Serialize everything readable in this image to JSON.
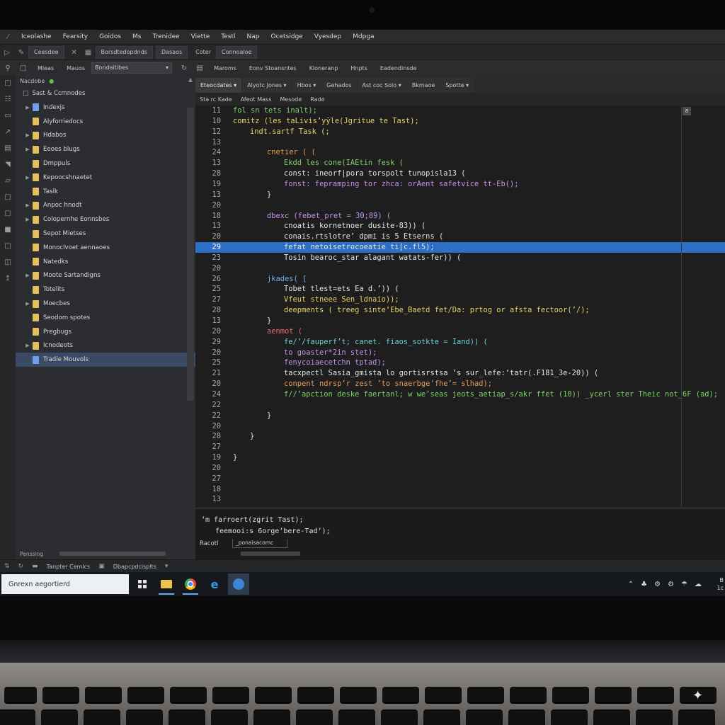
{
  "menubar": {
    "items": [
      "Iceolashe",
      "Fearsity",
      "Goidos",
      "Ms",
      "Trenidee",
      "Viette",
      "Testl",
      "Nap",
      "Ocetsidge",
      "Vyesdep",
      "Mdpga"
    ]
  },
  "toolbar1": {
    "items": [
      "Ceesdee",
      "Borsdtedopdnds",
      "Dasaos",
      "Coter",
      "Connoaloe"
    ]
  },
  "toolbar2": {
    "items": [
      "Mieas",
      "Mauos",
      "Maroms",
      "Eonv Stoansntes",
      "Kloneranp",
      "Hnpts",
      "Eadendinsde"
    ],
    "select_value": "Bondaitibes"
  },
  "explorer": {
    "header": "Nacdobe",
    "root": "Sast & Ccmnodes",
    "items": [
      {
        "label": "Indexjs",
        "kind": "file",
        "arrow": true
      },
      {
        "label": "Alyforriedocs",
        "kind": "folder",
        "arrow": false
      },
      {
        "label": "Hdabos",
        "kind": "folder",
        "arrow": true
      },
      {
        "label": "Eeoes blugs",
        "kind": "folder",
        "arrow": true
      },
      {
        "label": "Dmppuls",
        "kind": "folder",
        "arrow": false
      },
      {
        "label": "Kepoocshnaetet",
        "kind": "folder",
        "arrow": true
      },
      {
        "label": "Taslk",
        "kind": "folder",
        "arrow": false
      },
      {
        "label": "Anpoc hnodt",
        "kind": "folder",
        "arrow": true
      },
      {
        "label": "Colopernhe Eonnsbes",
        "kind": "folder",
        "arrow": true
      },
      {
        "label": "Sepot Mietses",
        "kind": "folder",
        "arrow": false
      },
      {
        "label": "Monoclvoet aennaoes",
        "kind": "folder",
        "arrow": false
      },
      {
        "label": "Natedks",
        "kind": "folder",
        "arrow": false
      },
      {
        "label": "Moote Sartandigns",
        "kind": "folder",
        "arrow": true
      },
      {
        "label": "Totelits",
        "kind": "folder",
        "arrow": false
      },
      {
        "label": "Moecbes",
        "kind": "folder",
        "arrow": true
      },
      {
        "label": "Seodom spotes",
        "kind": "folder",
        "arrow": false
      },
      {
        "label": "Pregbugs",
        "kind": "folder",
        "arrow": false
      },
      {
        "label": "Icnodeots",
        "kind": "folder",
        "arrow": true
      },
      {
        "label": "Tradie Mouvols",
        "kind": "file",
        "arrow": false,
        "selected": true
      }
    ],
    "footer": "Penssing"
  },
  "editor": {
    "tabs": [
      "Eteocdates",
      "Alyotc Jones",
      "Hbos",
      "Gehados",
      "Ast coc Solo",
      "Bkmaoe",
      "Spotte"
    ],
    "breadcrumb": [
      "Sta rc Kade",
      "Afeot Mass",
      "Mesode",
      "Rade"
    ],
    "minimap_label": "8",
    "lines": [
      {
        "n": "11",
        "indent": 0,
        "text": "fol sn tets inalt);",
        "color": "g"
      },
      {
        "n": "10",
        "indent": 0,
        "text": "comitz (les taLivisʼyȳle(Jgritue te Tast);",
        "color": "y"
      },
      {
        "n": "12",
        "indent": 2,
        "text": "indt.sartf Task (;",
        "color": "y"
      },
      {
        "n": "13",
        "indent": 0,
        "text": "",
        "color": "w"
      },
      {
        "n": "24",
        "indent": 4,
        "text": "cnetier ( (",
        "color": "o"
      },
      {
        "n": "13",
        "indent": 6,
        "text": "Ekdd les cone(IAEtin fesk (",
        "color": "g"
      },
      {
        "n": "28",
        "indent": 6,
        "text": "const: ineorf|pora torspolt tunopisla13 (",
        "color": "w"
      },
      {
        "n": "19",
        "indent": 6,
        "text": "fonst: fepramping tor zhca: orAent safetvice tt-Eb();",
        "color": "p"
      },
      {
        "n": "13",
        "indent": 4,
        "text": "}",
        "color": "w"
      },
      {
        "n": "20",
        "indent": 0,
        "text": "",
        "color": "w"
      },
      {
        "n": "18",
        "indent": 4,
        "text": "dbexc (febet_pret = 30;89) (",
        "color": "p"
      },
      {
        "n": "13",
        "indent": 6,
        "text": "cnoatis kornetnoer dusite-83)) (",
        "color": "w"
      },
      {
        "n": "20",
        "indent": 6,
        "text": "conais.rtslotreʼ dpmi is 5 Etserns (",
        "color": "w"
      },
      {
        "n": "29",
        "indent": 6,
        "text": "fefat netoisetrocoeatie ti[c.fl5);",
        "color": "w",
        "highlight": true
      },
      {
        "n": "23",
        "indent": 6,
        "text": "Tosin bearoc_star alagant watats-fer)) (",
        "color": "w"
      },
      {
        "n": "20",
        "indent": 0,
        "text": "",
        "color": "w"
      },
      {
        "n": "26",
        "indent": 4,
        "text": "jkades( [",
        "color": "b"
      },
      {
        "n": "25",
        "indent": 6,
        "text": "Tobet tlest=ets Ea d.ʼ)) (",
        "color": "w"
      },
      {
        "n": "27",
        "indent": 6,
        "text": "Vfeut stneee Sen_ldnaio));",
        "color": "y"
      },
      {
        "n": "28",
        "indent": 6,
        "text": "deepments ( treeg sinteʻEbe_Baetd fet/Da: prtog or afsta fectoor(ʼ/);",
        "color": "y"
      },
      {
        "n": "13",
        "indent": 4,
        "text": "}",
        "color": "w"
      },
      {
        "n": "20",
        "indent": 4,
        "text": "aenmot (",
        "color": "r"
      },
      {
        "n": "29",
        "indent": 6,
        "text": "fe/ʼ/fauperfʼt; canet. fiaos_sotkte = Iand)) (",
        "color": "c"
      },
      {
        "n": "20",
        "indent": 6,
        "text": "to goaster*2in stet);",
        "color": "p"
      },
      {
        "n": "25",
        "indent": 6,
        "text": "fenycoiaecetchn tptad);",
        "color": "p"
      },
      {
        "n": "21",
        "indent": 6,
        "text": "tacxpectl Sasia_gmista lo gortisrstsa ʼs sur_lefe:ʻtatr(.F181_3e-20)) (",
        "color": "w"
      },
      {
        "n": "20",
        "indent": 6,
        "text": "conpent ndrspʼr zest ʼto snaerbge'fheʼ= slhad);",
        "color": "o"
      },
      {
        "n": "24",
        "indent": 6,
        "text": "f//ʼapction deske faertanl; w weʼseas jeots_aetiap_s/akr ffet (10)) _ycerl ster Theic not_6F (ad);",
        "color": "g"
      },
      {
        "n": "22",
        "indent": 0,
        "text": "",
        "color": "w"
      },
      {
        "n": "22",
        "indent": 4,
        "text": "}",
        "color": "w"
      },
      {
        "n": "20",
        "indent": 0,
        "text": "",
        "color": "w"
      },
      {
        "n": "28",
        "indent": 2,
        "text": "}",
        "color": "w"
      },
      {
        "n": "27",
        "indent": 0,
        "text": "",
        "color": "w"
      },
      {
        "n": "19",
        "indent": 0,
        "text": "}",
        "color": "w"
      },
      {
        "n": "20",
        "indent": 0,
        "text": "",
        "color": "w"
      },
      {
        "n": "27",
        "indent": 0,
        "text": "",
        "color": "w"
      },
      {
        "n": "18",
        "indent": 0,
        "text": "",
        "color": "w"
      },
      {
        "n": "13",
        "indent": 0,
        "text": "",
        "color": "w"
      }
    ]
  },
  "terminal": {
    "line1": "ʼm farroert(zgrit Tast);",
    "line2": "feemooi:s 6orgeʼbere-Tadʼ);",
    "prompt": "Racotl",
    "input": "_ponaisacomc"
  },
  "statusbar": {
    "items": [
      "Tanpter Cemlcs",
      "Dbapcpdcisplts"
    ]
  },
  "taskbar": {
    "search_placeholder": "Gnrexn aegortierd",
    "tray_time": "B",
    "tray_date": "1c"
  },
  "colors": {
    "highlight": "#2d6fc7",
    "editor_bg": "#1e1e1f",
    "sidebar_bg": "#2c2d30",
    "folder": "#e2c15c",
    "taskbar_accent": "#6aa6ee"
  }
}
